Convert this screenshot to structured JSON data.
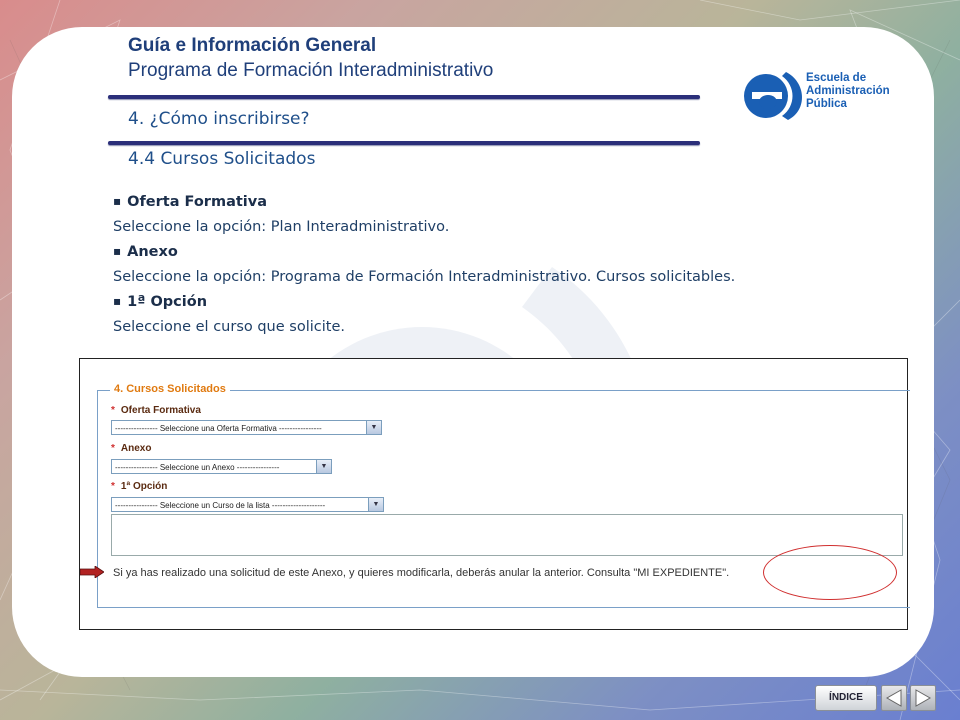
{
  "header": {
    "title_bold": "Guía e Información General",
    "title_sub": "Programa de Formación Interadministrativo",
    "section": "4. ¿Cómo inscribirse?",
    "subsection": "4.4 Cursos Solicitados"
  },
  "logo": {
    "mark": "e)",
    "lines": [
      "Escuela de",
      "Administración",
      "Pública"
    ]
  },
  "instructions": [
    {
      "heading": "Oferta Formativa",
      "text": "Seleccione la opción: Plan Interadministrativo."
    },
    {
      "heading": "Anexo",
      "text": "Seleccione la opción: Programa de Formación Interadministrativo. Cursos solicitables."
    },
    {
      "heading": "1ª Opción",
      "text": "Seleccione el curso que solicite."
    }
  ],
  "form": {
    "legend": "4. Cursos Solicitados",
    "fields": [
      {
        "label": "Oferta Formativa",
        "value": "---------------- Seleccione una Oferta Formativa ----------------"
      },
      {
        "label": "Anexo",
        "value": "---------------- Seleccione un Anexo ----------------"
      },
      {
        "label": "1ª Opción",
        "value": "---------------- Seleccione un Curso de la lista --------------------"
      }
    ],
    "required_marker": "*",
    "notice": "Si ya has realizado una solicitud de este Anexo, y quieres modificarla, deberás anular la anterior. Consulta \"MI EXPEDIENTE\"."
  },
  "nav": {
    "index_label": "ÍNDICE",
    "prev_icon": "triangle-left-icon",
    "next_icon": "triangle-right-icon"
  },
  "colors": {
    "title": "#1f3f7a",
    "rule": "#2b2f7a",
    "legend": "#e07a10",
    "highlight": "#d03030",
    "logo": "#1a5fb4"
  }
}
